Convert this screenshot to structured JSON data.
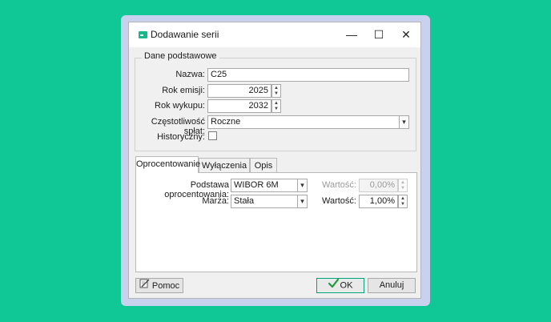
{
  "window": {
    "title": "Dodawanie serii",
    "minimize_glyph": "—",
    "maximize_glyph": "☐",
    "close_glyph": "✕"
  },
  "basic": {
    "legend": "Dane podstawowe",
    "name_label": "Nazwa:",
    "name_value": "C25",
    "issue_year_label": "Rok emisji:",
    "issue_year_value": "2025",
    "redemption_year_label": "Rok wykupu:",
    "redemption_year_value": "2032",
    "frequency_label": "Częstotliwość spłat:",
    "frequency_value": "Roczne",
    "historical_label": "Historyczny:",
    "historical_checked": false
  },
  "tabs": [
    {
      "label": "Oprocentowanie",
      "active": true
    },
    {
      "label": "Wyłączenia",
      "active": false
    },
    {
      "label": "Opis",
      "active": false
    }
  ],
  "interest": {
    "base_label": "Podstawa oprocentowania:",
    "base_value": "WIBOR 6M",
    "value1_label": "Wartość:",
    "value1_value": "0,00%",
    "margin_label": "Marża:",
    "margin_value": "Stała",
    "value2_label": "Wartość:",
    "value2_value": "1,00%"
  },
  "buttons": {
    "help": "Pomoc",
    "ok": "OK",
    "cancel": "Anuluj"
  },
  "icons": {
    "app": "card-icon",
    "help": "help-pencil-icon",
    "ok": "checkmark-icon",
    "spin_up": "▲",
    "spin_down": "▼",
    "dropdown": "▾"
  },
  "colors": {
    "background": "#0fc896",
    "frame": "#c8d1ee",
    "accent": "#0a9e78"
  }
}
